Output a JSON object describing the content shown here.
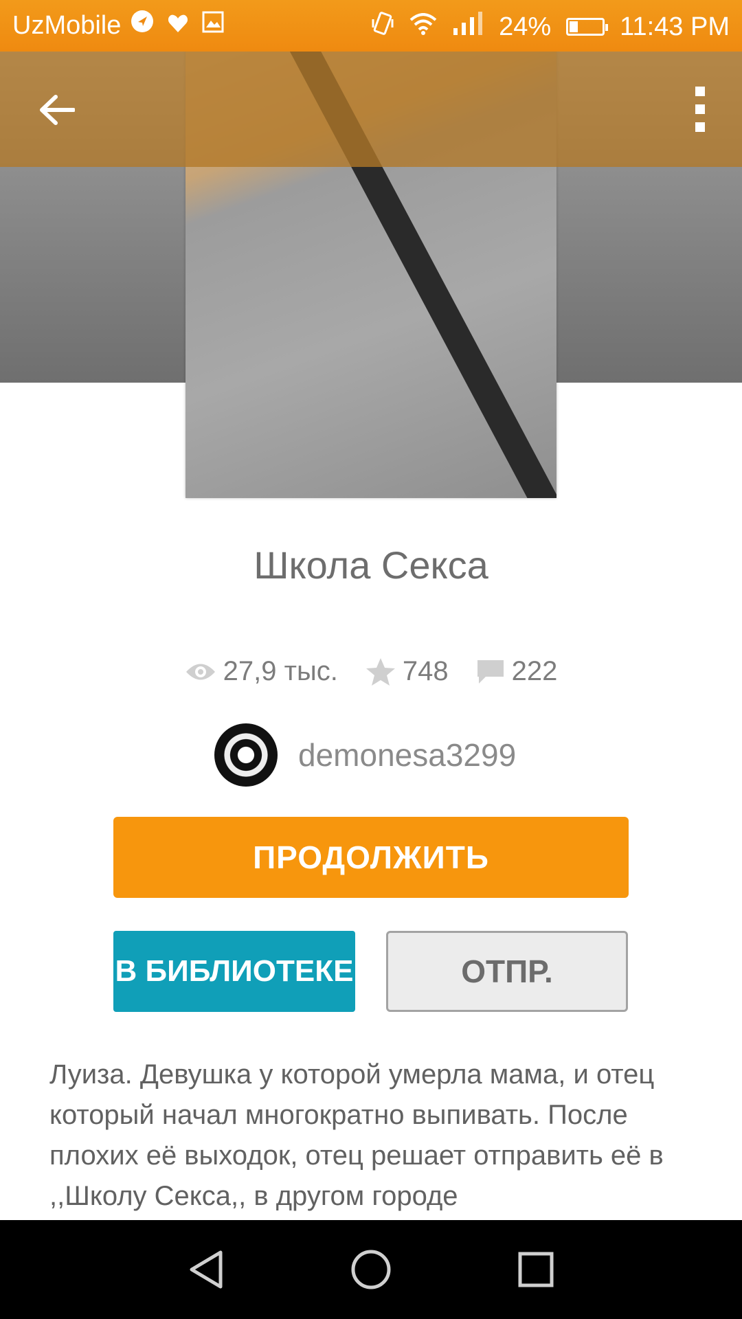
{
  "status_bar": {
    "carrier": "UzMobile",
    "battery": "24%",
    "time": "11:43 PM",
    "icons": [
      "navigation-icon",
      "heart-icon",
      "image-icon",
      "vibrate-icon",
      "wifi-icon",
      "signal-icon",
      "battery-icon"
    ]
  },
  "toolbar": {
    "back_icon": "arrow-left-icon",
    "menu_icon": "more-vert-icon"
  },
  "story": {
    "title": "Школа Секса",
    "views": "27,9 тыс.",
    "votes": "748",
    "comments": "222",
    "author": "demonesa3299",
    "description": "Луиза. Девушка у которой умерла мама, и отец который начал многократно выпивать. После плохих её выходок, отец решает отправить её в ,,Школу Секса,, в другом городе"
  },
  "actions": {
    "continue_label": "ПРОДОЛЖИТЬ",
    "library_label": "В БИБЛИОТЕКЕ",
    "send_label": "ОТПР."
  },
  "colors": {
    "accent": "#f7960d",
    "library": "#109fb8",
    "statusbar": "#ef8a10"
  }
}
